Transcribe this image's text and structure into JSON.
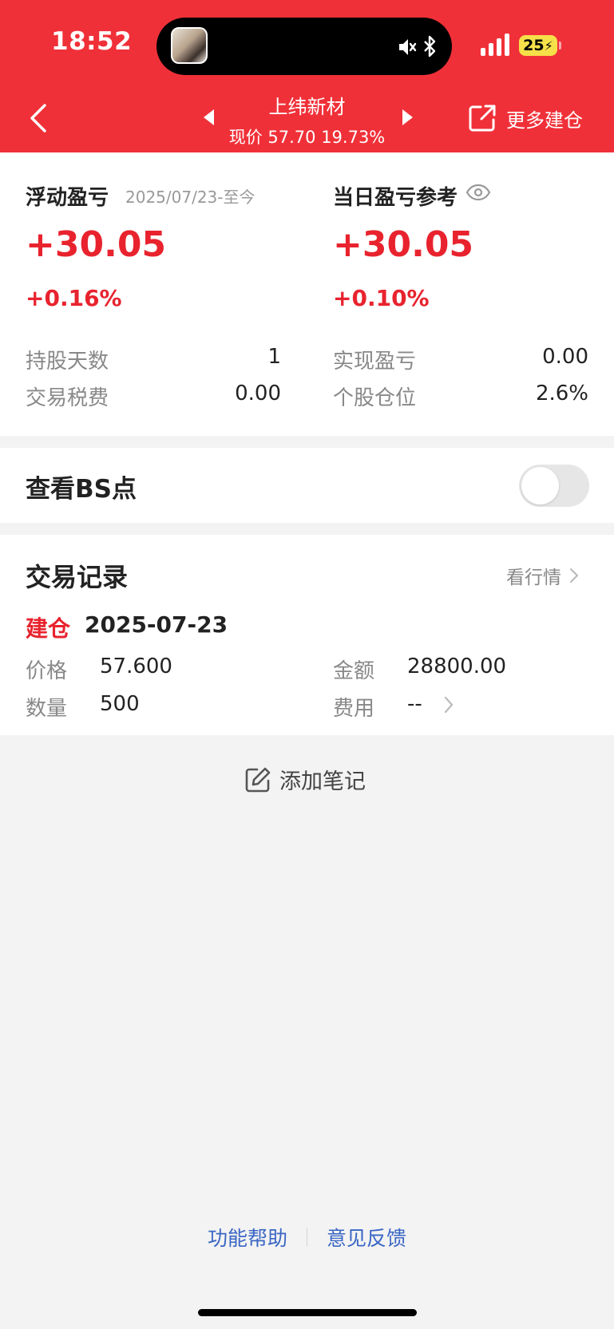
{
  "status_bar": {
    "time": "18:52",
    "battery": "25"
  },
  "header": {
    "stock_name": "上纬新材",
    "price_line": "现价 57.70 19.73%",
    "more_label": "更多建仓"
  },
  "summary": {
    "float_title": "浮动盈亏",
    "float_date": "2025/07/23-至今",
    "float_value": "+30.05",
    "float_pct": "+0.16%",
    "daily_title": "当日盈亏参考",
    "daily_value": "+30.05",
    "daily_pct": "+0.10%",
    "hold_days_label": "持股天数",
    "hold_days_value": "1",
    "tax_label": "交易税费",
    "tax_value": "0.00",
    "realized_label": "实现盈亏",
    "realized_value": "0.00",
    "position_label": "个股仓位",
    "position_value": "2.6%"
  },
  "bs_toggle": {
    "label": "查看BS点",
    "enabled": false
  },
  "trade_records": {
    "title": "交易记录",
    "link_label": "看行情",
    "type": "建仓",
    "date": "2025-07-23",
    "price_label": "价格",
    "price_value": "57.600",
    "amount_label": "金额",
    "amount_value": "28800.00",
    "qty_label": "数量",
    "qty_value": "500",
    "fee_label": "费用",
    "fee_value": "--"
  },
  "add_note_label": "添加笔记",
  "footer": {
    "help": "功能帮助",
    "feedback": "意见反馈"
  },
  "colors": {
    "brand_red": "#f03038",
    "gain_red": "#e8232e",
    "link_blue": "#3a66c4"
  }
}
